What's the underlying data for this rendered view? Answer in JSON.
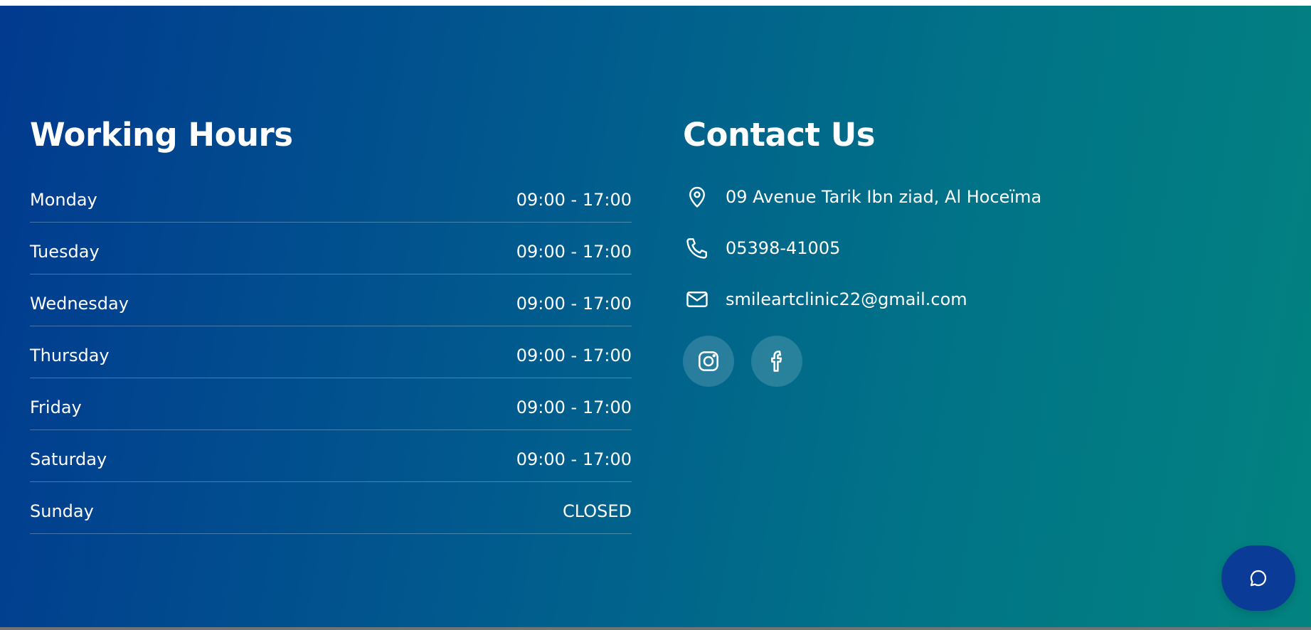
{
  "hours": {
    "title": "Working Hours",
    "rows": [
      {
        "day": "Monday",
        "time": "09:00 - 17:00"
      },
      {
        "day": "Tuesday",
        "time": "09:00 - 17:00"
      },
      {
        "day": "Wednesday",
        "time": "09:00 - 17:00"
      },
      {
        "day": "Thursday",
        "time": "09:00 - 17:00"
      },
      {
        "day": "Friday",
        "time": "09:00 - 17:00"
      },
      {
        "day": "Saturday",
        "time": "09:00 - 17:00"
      },
      {
        "day": "Sunday",
        "time": "CLOSED"
      }
    ]
  },
  "contact": {
    "title": "Contact Us",
    "address": "09 Avenue Tarik Ibn ziad, Al Hoceïma",
    "phone": "05398-41005",
    "email": "smileartclinic22@gmail.com",
    "icons": {
      "address": "map-pin-icon",
      "phone": "phone-icon",
      "email": "mail-icon"
    },
    "socials": [
      {
        "name": "instagram",
        "icon": "instagram-icon"
      },
      {
        "name": "facebook",
        "icon": "facebook-icon"
      }
    ]
  },
  "chat": {
    "icon": "chat-bubble-icon",
    "color": "#0a3b97"
  },
  "theme": {
    "gradient_start": "#013a8f",
    "gradient_end": "#028380",
    "text": "#ffffff"
  }
}
